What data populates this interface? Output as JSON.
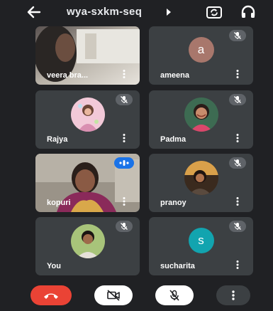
{
  "meeting": {
    "code": "wya-sxkm-seq"
  },
  "colors": {
    "background": "#202124",
    "tile": "#3c4043",
    "end_call": "#ea4335",
    "speaking": "#1a73e8",
    "avatar_ameena": "#a8776c",
    "avatar_sucharita": "#12a4af"
  },
  "participants": [
    {
      "name": "veera bra...",
      "muted": false,
      "avatar": "video"
    },
    {
      "name": "ameena",
      "muted": true,
      "avatar": "letter",
      "letter": "a"
    },
    {
      "name": "Rajya",
      "muted": true,
      "avatar": "photo"
    },
    {
      "name": "Padma",
      "muted": true,
      "avatar": "photo"
    },
    {
      "name": "kopuri",
      "muted": false,
      "speaking": true,
      "avatar": "video"
    },
    {
      "name": "pranoy",
      "muted": true,
      "avatar": "photo"
    },
    {
      "name": "You",
      "muted": true,
      "avatar": "photo"
    },
    {
      "name": "sucharita",
      "muted": true,
      "avatar": "letter",
      "letter": "s"
    }
  ],
  "icons": {
    "back": "arrow-left-icon",
    "info": "caret-right-icon",
    "flip_camera": "flip-camera-icon",
    "audio": "headphones-icon",
    "mute": "mic-off-icon",
    "more": "more-vert-icon",
    "speaking": "audio-level-icon",
    "end_call": "call-end-icon",
    "camera_off": "videocam-off-icon"
  }
}
